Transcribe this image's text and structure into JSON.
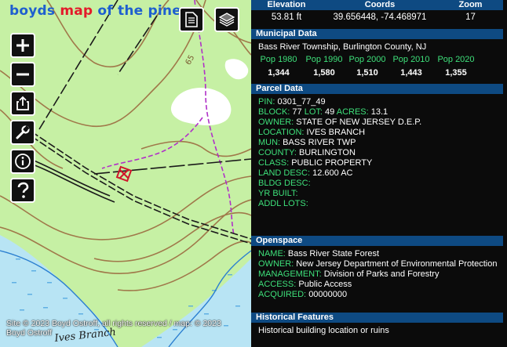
{
  "brand": {
    "part1": "boyds ",
    "part2": "map",
    "part3": " of the pines"
  },
  "map": {
    "label_65": "65",
    "label_creek": "Ives Branch",
    "credit": "Site © 2023 Boyd Ostroff, all rights reserved / map: © 2023 Boyd Ostroff",
    "colors": {
      "land": "#c6f0a4",
      "contour": "#a0784a",
      "water": "#4aa3e0",
      "trail": "#b030c8",
      "road": "#1a1a1a"
    }
  },
  "toolbar": {
    "buttons": [
      {
        "name": "zoom-in-button",
        "icon": "plus-icon"
      },
      {
        "name": "zoom-out-button",
        "icon": "minus-icon"
      },
      {
        "name": "share-button",
        "icon": "share-icon"
      },
      {
        "name": "tools-button",
        "icon": "wrench-icon"
      },
      {
        "name": "info-button",
        "icon": "info-icon"
      },
      {
        "name": "help-button",
        "icon": "question-icon"
      }
    ],
    "top_buttons": [
      {
        "name": "document-button",
        "icon": "document-icon"
      },
      {
        "name": "layers-button",
        "icon": "layers-icon"
      }
    ]
  },
  "location": {
    "headers": [
      "Elevation",
      "Coords",
      "Zoom"
    ],
    "elevation": "53.81 ft",
    "coords": "39.656448, -74.468971",
    "zoom": "17"
  },
  "municipal": {
    "title": "Municipal Data",
    "name": "Bass River Township, Burlington County, NJ",
    "pop_labels": [
      "Pop 1980",
      "Pop 1990",
      "Pop 2000",
      "Pop 2010",
      "Pop 2020"
    ],
    "pop_values": [
      "1,344",
      "1,580",
      "1,510",
      "1,443",
      "1,355"
    ]
  },
  "parcel": {
    "title": "Parcel Data",
    "pin_label": "PIN:",
    "pin": "0301_77_49",
    "block_label": "BLOCK:",
    "block": "77",
    "lot_label": "LOT:",
    "lot": "49",
    "acres_label": "ACRES:",
    "acres": "13.1",
    "owner_label": "OWNER:",
    "owner": "STATE OF NEW JERSEY D.E.P.",
    "location_label": "LOCATION:",
    "location": "IVES BRANCH",
    "mun_label": "MUN:",
    "mun": "BASS RIVER TWP",
    "county_label": "COUNTY:",
    "county": "BURLINGTON",
    "class_label": "CLASS:",
    "class": "PUBLIC PROPERTY",
    "land_label": "LAND DESC:",
    "land": "12.600 AC",
    "bldg_label": "BLDG DESC:",
    "yr_label": "YR BUILT:",
    "addl_label": "ADDL LOTS:"
  },
  "openspace": {
    "title": "Openspace",
    "name_label": "NAME:",
    "name": "Bass River State Forest",
    "owner_label": "OWNER:",
    "owner": "New Jersey Department of Environmental Protection",
    "mgmt_label": "MANAGEMENT:",
    "mgmt": "Division of Parks and Forestry",
    "access_label": "ACCESS:",
    "access": "Public Access",
    "acquired_label": "ACQUIRED:",
    "acquired": "00000000"
  },
  "historical": {
    "title": "Historical Features",
    "text": "Historical building location or ruins"
  }
}
